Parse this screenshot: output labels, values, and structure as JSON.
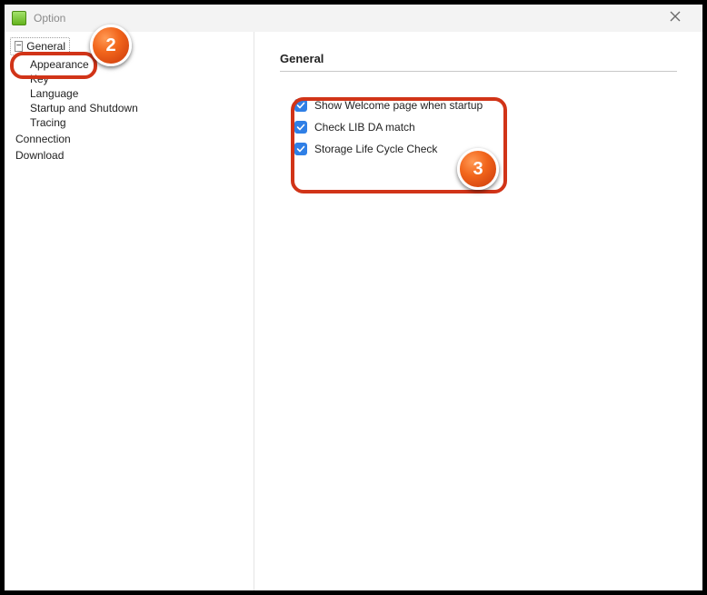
{
  "window": {
    "title": "Option"
  },
  "tree": {
    "root": {
      "label": "General"
    },
    "children": [
      {
        "label": "Appearance"
      },
      {
        "label": "Key"
      },
      {
        "label": "Language"
      },
      {
        "label": "Startup and Shutdown"
      },
      {
        "label": "Tracing"
      }
    ],
    "siblings": [
      {
        "label": "Connection"
      },
      {
        "label": "Download"
      }
    ]
  },
  "main": {
    "heading": "General",
    "checks": [
      {
        "label": "Show Welcome page when startup"
      },
      {
        "label": "Check LIB DA match"
      },
      {
        "label": "Storage Life Cycle Check"
      }
    ]
  },
  "annotations": {
    "step2": "2",
    "step3": "3"
  }
}
